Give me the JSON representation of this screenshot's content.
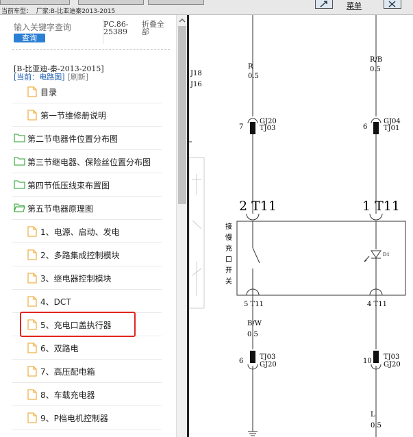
{
  "topbar": {
    "vehicle_label": "当前车型：",
    "manufacturer_label": "厂家:B-比亚迪秦2013-2015",
    "menu_label": "菜单"
  },
  "search": {
    "placeholder": "输入关键字查询",
    "button_label": "查询"
  },
  "pc_code": [
    "PC.86-",
    "25389"
  ],
  "fold_all": [
    "折叠全",
    "部"
  ],
  "car_model": "[B-比亚迪-秦-2013-2015]",
  "current": {
    "label": "[当前：电路图]",
    "refresh": "[刷新]"
  },
  "tree": [
    {
      "label": "目录",
      "type": "file",
      "level": 2
    },
    {
      "label": "第一节维修册说明",
      "type": "file",
      "level": 2
    },
    {
      "label": "第二节电器件位置分布图",
      "type": "folder",
      "level": 1
    },
    {
      "label": "第三节继电器、保险丝位置分布图",
      "type": "folder",
      "level": 1
    },
    {
      "label": "第四节低压线束布置图",
      "type": "folder",
      "level": 1
    },
    {
      "label": "第五节电器原理图",
      "type": "folder-open",
      "level": 1
    },
    {
      "label": "1、电源、启动、发电",
      "type": "file",
      "level": 2
    },
    {
      "label": "2、多路集成控制模块",
      "type": "file",
      "level": 2
    },
    {
      "label": "3、继电器控制模块",
      "type": "file",
      "level": 2
    },
    {
      "label": "4、DCT",
      "type": "file",
      "level": 2
    },
    {
      "label": "5、充电口盖执行器",
      "type": "file",
      "level": 2,
      "highlighted": true
    },
    {
      "label": "6、双路电",
      "type": "file",
      "level": 2
    },
    {
      "label": "7、高压配电箱",
      "type": "file",
      "level": 2
    },
    {
      "label": "8、车载充电器",
      "type": "file",
      "level": 2
    },
    {
      "label": "9、P档电机控制器",
      "type": "file",
      "level": 2
    }
  ],
  "diagram": {
    "left_margin_labels": [
      "J18",
      "J16"
    ],
    "wire_left_top": {
      "color": "R",
      "gauge": "0.5"
    },
    "wire_right_top": {
      "color": "R/B",
      "gauge": "0.5"
    },
    "conn_left_top": {
      "pin": "7",
      "codes": [
        "GJ20",
        "TJ03"
      ]
    },
    "conn_right_top": {
      "pin": "6",
      "codes": [
        "GJ04",
        "TJ01"
      ]
    },
    "module_left_label": "2 T11",
    "module_right_label": "1 T11",
    "module_name": [
      "接",
      "慢",
      "充",
      "口",
      "开",
      "关"
    ],
    "diode_label": "D1",
    "pin_left_bottom": "5 T11",
    "pin_right_bottom": "4 T11",
    "wire_left_bottom": {
      "color": "B/W",
      "gauge": "0.5"
    },
    "conn_left_bottom": {
      "pin": "6",
      "codes": [
        "TJ03",
        "GJ20"
      ]
    },
    "conn_right_bottom": {
      "pin": "10",
      "codes": [
        "TJ03",
        "GJ20"
      ]
    },
    "wire_right_bottom": {
      "color": "L",
      "gauge": "0.5"
    }
  },
  "colors": {
    "accent": "#2b7fd4",
    "highlight": "#e0261f",
    "folder": "#4caf50",
    "file": "#f0b24a"
  }
}
